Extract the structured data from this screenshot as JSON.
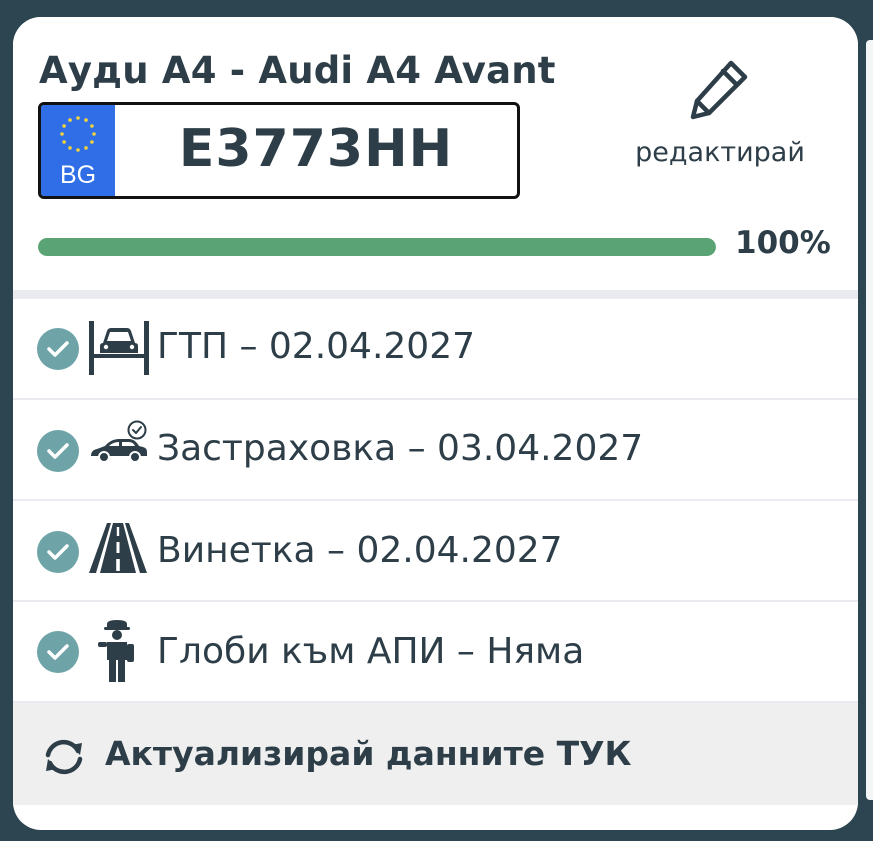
{
  "vehicle": {
    "title": "Аyдu A4 - Audi A4 Avant",
    "plate": {
      "country": "BG",
      "number": "E3773HH"
    },
    "edit_label": "редактирай"
  },
  "progress": {
    "value": 1.0,
    "label": "100%"
  },
  "statuses": [
    {
      "icon": "car-inspection-icon",
      "text": "ГТП – 02.04.2027",
      "ok": true
    },
    {
      "icon": "car-insurance-icon",
      "text": "Застраховка – 03.04.2027",
      "ok": true
    },
    {
      "icon": "highway-vignette-icon",
      "text": "Винетка – 02.04.2027",
      "ok": true
    },
    {
      "icon": "traffic-police-icon",
      "text": "Глоби към АПИ – Няма",
      "ok": true
    }
  ],
  "refresh": {
    "label": "Актуализирай данните ТУК",
    "icon": "refresh-icon"
  },
  "colors": {
    "background": "#2c4550",
    "text": "#2d3e48",
    "progress": "#5aa374",
    "check": "#6ea4a8",
    "plate_eu": "#2f6ee6"
  }
}
